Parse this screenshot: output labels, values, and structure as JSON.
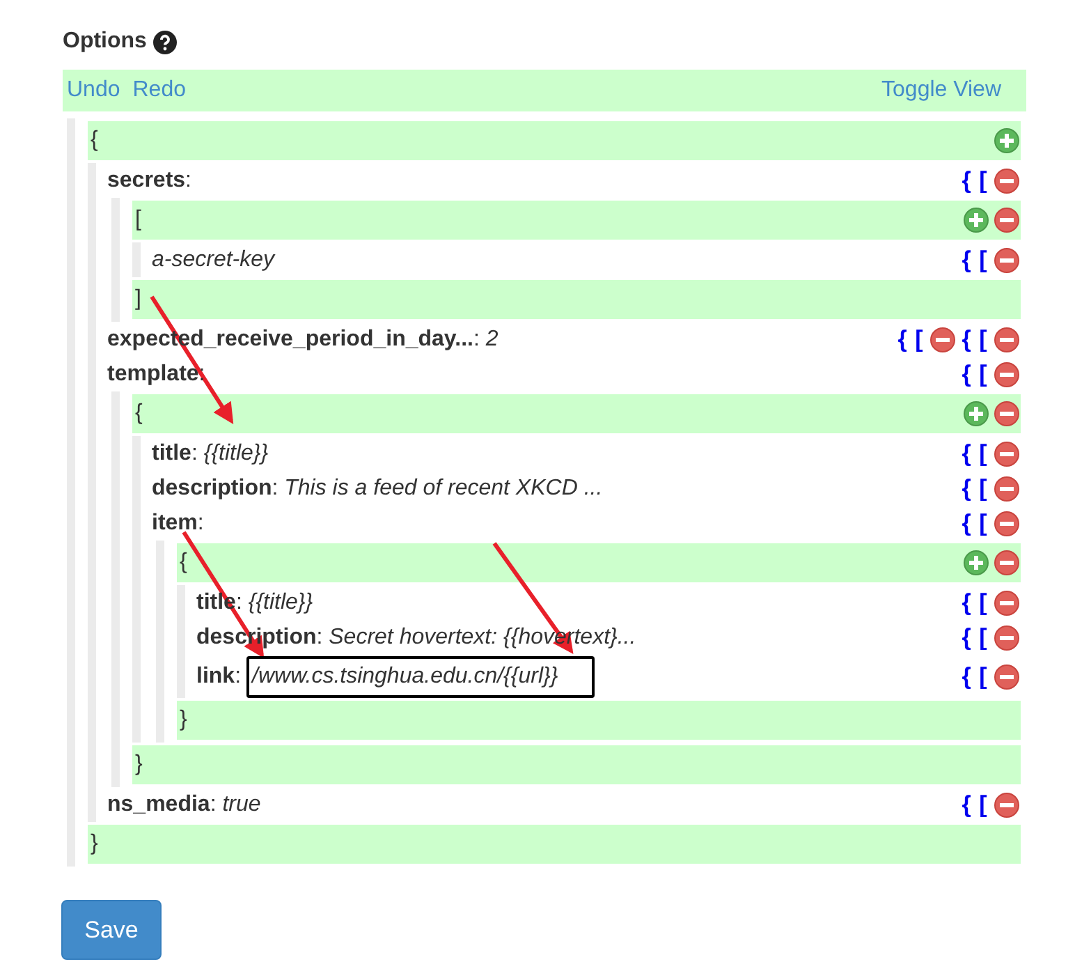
{
  "header": {
    "title": "Options"
  },
  "toolbar": {
    "links": [
      "Undo",
      "Redo"
    ],
    "toggle": "Toggle View"
  },
  "tree": {
    "open": "{",
    "close": "}",
    "actions": [
      {
        "kind": "add"
      }
    ],
    "children": [
      {
        "label": "**secrets**:",
        "actions": [
          {
            "kind": "type",
            "text": "{"
          },
          {
            "kind": "type",
            "text": "["
          },
          {
            "kind": "remove"
          }
        ],
        "block": {
          "open": "[",
          "close": "]",
          "actions": [
            {
              "kind": "add"
            },
            {
              "kind": "remove"
            }
          ],
          "children": [
            {
              "label": "*a-secret-key*",
              "actions": [
                {
                  "kind": "type",
                  "text": "{"
                },
                {
                  "kind": "type",
                  "text": "["
                },
                {
                  "kind": "remove"
                }
              ]
            }
          ]
        }
      },
      {
        "label": "**expected_receive_period_in_day...**: *2*",
        "actions": [
          {
            "kind": "type",
            "text": "{"
          },
          {
            "kind": "type",
            "text": "["
          },
          {
            "kind": "remove"
          },
          {
            "kind": "type",
            "text": "{"
          },
          {
            "kind": "type",
            "text": "["
          },
          {
            "kind": "remove"
          }
        ]
      },
      {
        "label": "**template**:",
        "actions": [
          {
            "kind": "type",
            "text": "{"
          },
          {
            "kind": "type",
            "text": "["
          },
          {
            "kind": "remove"
          }
        ],
        "block": {
          "open": "{",
          "close": "}",
          "actions": [
            {
              "kind": "add"
            },
            {
              "kind": "remove"
            }
          ],
          "children": [
            {
              "label": "**title**: *{{title}}*",
              "actions": [
                {
                  "kind": "type",
                  "text": "{"
                },
                {
                  "kind": "type",
                  "text": "["
                },
                {
                  "kind": "remove"
                }
              ]
            },
            {
              "label": "**description**: *This is a feed of recent XKCD ...*",
              "actions": [
                {
                  "kind": "type",
                  "text": "{"
                },
                {
                  "kind": "type",
                  "text": "["
                },
                {
                  "kind": "remove"
                }
              ]
            },
            {
              "label": "**item**:",
              "actions": [
                {
                  "kind": "type",
                  "text": "{"
                },
                {
                  "kind": "type",
                  "text": "["
                },
                {
                  "kind": "remove"
                }
              ],
              "block": {
                "open": "{",
                "close": "}",
                "actions": [
                  {
                    "kind": "add"
                  },
                  {
                    "kind": "remove"
                  }
                ],
                "children": [
                  {
                    "label": "**title**: *{{title}}*",
                    "actions": [
                      {
                        "kind": "type",
                        "text": "{"
                      },
                      {
                        "kind": "type",
                        "text": "["
                      },
                      {
                        "kind": "remove"
                      }
                    ]
                  },
                  {
                    "label": "**description**: *Secret hovertext: {{hovertext}...*",
                    "actions": [
                      {
                        "kind": "type",
                        "text": "{"
                      },
                      {
                        "kind": "type",
                        "text": "["
                      },
                      {
                        "kind": "remove"
                      }
                    ]
                  },
                  {
                    "label": "**link**:",
                    "input": "/www.cs.tsinghua.edu.cn/{{url}}",
                    "actions": [
                      {
                        "kind": "type",
                        "text": "{"
                      },
                      {
                        "kind": "type",
                        "text": "["
                      },
                      {
                        "kind": "remove"
                      }
                    ]
                  }
                ]
              }
            }
          ]
        }
      },
      {
        "label": "**ns_media**: *true*",
        "actions": [
          {
            "kind": "type",
            "text": "{"
          },
          {
            "kind": "type",
            "text": "["
          },
          {
            "kind": "remove"
          }
        ]
      }
    ]
  },
  "save_button": "Save"
}
